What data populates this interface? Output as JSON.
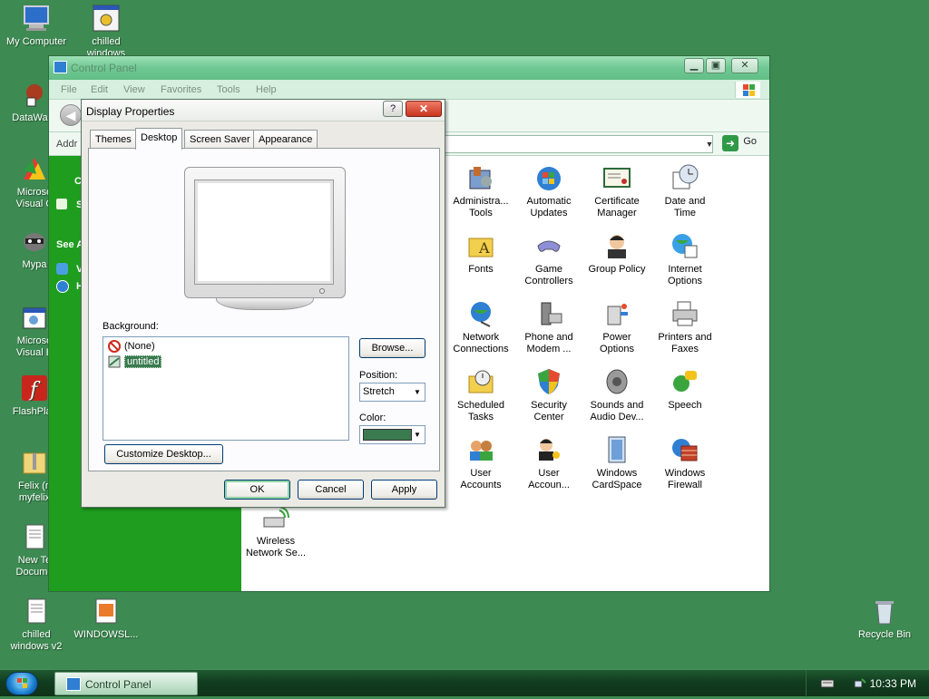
{
  "desktop": {
    "icons": {
      "my_computer": "My Computer",
      "chilled_top": "chilled\nwindows",
      "datawag": "DataWag",
      "ms_visual_c": "Microso\nVisual C",
      "mypal": "Mypa",
      "ms_visual_b": "Microso\nVisual B",
      "flashplayer": "FlashPlay",
      "felix": "Felix (n\nmyfelix",
      "new_text": "New Te\nDocume",
      "chilled_bottom": "chilled\nwindows v2",
      "windowsl": "WINDOWSL...",
      "recycle_bin": "Recycle Bin"
    }
  },
  "control_panel": {
    "title": "Control Panel",
    "menu": [
      "File",
      "Edit",
      "View",
      "Favorites",
      "Tools",
      "Help"
    ],
    "address_label": "Addr",
    "go_label": "Go",
    "left_pane": {
      "frag1": "C",
      "frag2": "S",
      "see_also": "See A",
      "frag3": "V",
      "frag4": "H"
    },
    "items": [
      "Administra...\nTools",
      "Automatic\nUpdates",
      "Certificate\nManager",
      "Date and\nTime",
      "Fonts",
      "Game\nControllers",
      "Group Policy",
      "Internet\nOptions",
      "Network\nConnections",
      "Phone and\nModem ...",
      "Power\nOptions",
      "Printers and\nFaxes",
      "Scheduled\nTasks",
      "Security\nCenter",
      "Sounds and\nAudio Dev...",
      "Speech",
      "User\nAccounts",
      "User\nAccoun...",
      "Windows\nCardSpace",
      "Windows\nFirewall",
      "Wireless\nNetwork Se..."
    ]
  },
  "dialog": {
    "title": "Display Properties",
    "help": "?",
    "close": "✕",
    "tabs": [
      "Themes",
      "Desktop",
      "Screen Saver",
      "Appearance"
    ],
    "active_tab": "Desktop",
    "background_label": "Background:",
    "background_items": [
      "(None)",
      "untitled"
    ],
    "selected_background": "untitled",
    "browse": "Browse...",
    "position_label": "Position:",
    "position_value": "Stretch",
    "color_label": "Color:",
    "color_value": "#3a7a4f",
    "customize": "Customize Desktop...",
    "ok": "OK",
    "cancel": "Cancel",
    "apply": "Apply"
  },
  "taskbar": {
    "task_label": "Control Panel",
    "clock": "10:33 PM"
  },
  "colors": {
    "desktop": "#3d8a52",
    "cp_left_pane": "#1f9d1f",
    "selection": "#3a7a4f"
  }
}
